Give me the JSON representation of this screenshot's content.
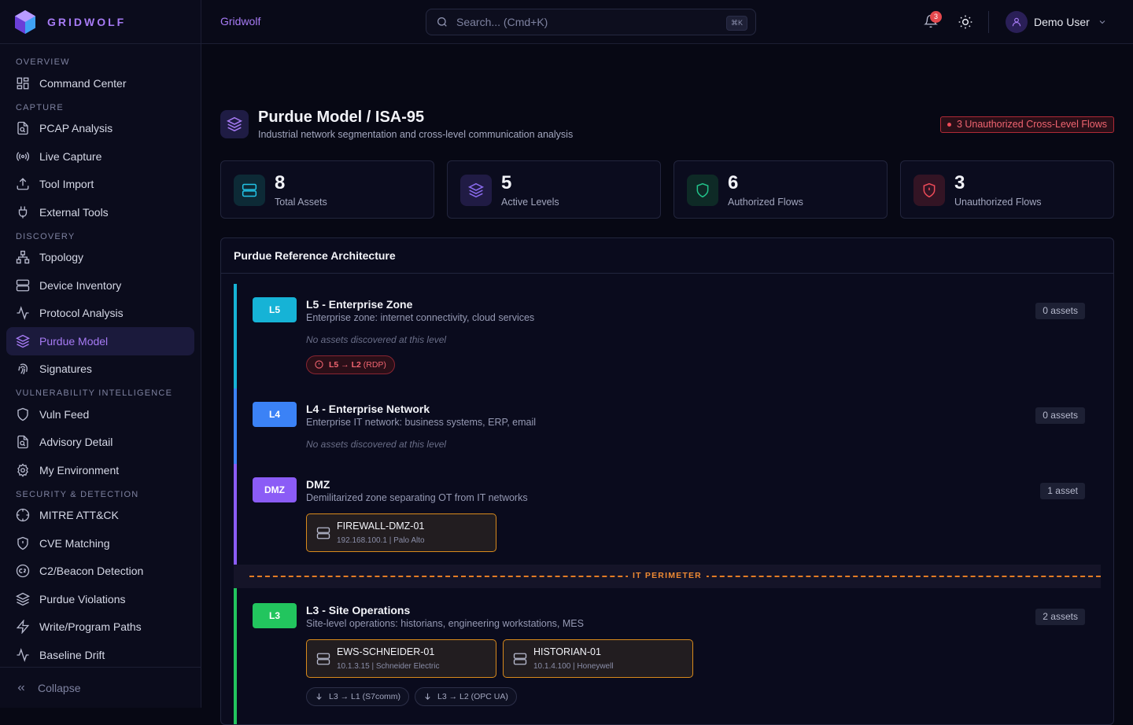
{
  "app": {
    "name": "GRIDWOLF",
    "brand": "Gridwolf"
  },
  "sidebar": {
    "sections": [
      {
        "title": "OVERVIEW",
        "items": [
          {
            "label": "Command Center",
            "icon": "grid-icon"
          }
        ]
      },
      {
        "title": "CAPTURE",
        "items": [
          {
            "label": "PCAP Analysis",
            "icon": "file-search-icon"
          },
          {
            "label": "Live Capture",
            "icon": "radio-icon"
          },
          {
            "label": "Tool Import",
            "icon": "upload-icon"
          },
          {
            "label": "External Tools",
            "icon": "plug-icon"
          }
        ]
      },
      {
        "title": "DISCOVERY",
        "items": [
          {
            "label": "Topology",
            "icon": "network-icon"
          },
          {
            "label": "Device Inventory",
            "icon": "server-icon"
          },
          {
            "label": "Protocol Analysis",
            "icon": "activity-icon"
          },
          {
            "label": "Purdue Model",
            "icon": "layers-icon",
            "active": true
          },
          {
            "label": "Signatures",
            "icon": "fingerprint-icon"
          }
        ]
      },
      {
        "title": "VULNERABILITY INTELLIGENCE",
        "items": [
          {
            "label": "Vuln Feed",
            "icon": "shield-icon"
          },
          {
            "label": "Advisory Detail",
            "icon": "file-search-icon"
          },
          {
            "label": "My Environment",
            "icon": "gear-icon"
          }
        ]
      },
      {
        "title": "SECURITY & DETECTION",
        "items": [
          {
            "label": "MITRE ATT&CK",
            "icon": "crosshair-icon"
          },
          {
            "label": "CVE Matching",
            "icon": "shield-alert-icon"
          },
          {
            "label": "C2/Beacon Detection",
            "icon": "c2-icon"
          },
          {
            "label": "Purdue Violations",
            "icon": "layers-icon"
          },
          {
            "label": "Write/Program Paths",
            "icon": "zap-icon"
          },
          {
            "label": "Baseline Drift",
            "icon": "activity-icon"
          }
        ]
      }
    ],
    "collapse_label": "Collapse"
  },
  "topbar": {
    "search_placeholder": "Search... (Cmd+K)",
    "shortcut": "⌘K",
    "notifications": "3",
    "user": "Demo User"
  },
  "page": {
    "title": "Purdue Model / ISA-95",
    "subtitle": "Industrial network segmentation and cross-level communication analysis",
    "alert": "3 Unauthorized Cross-Level Flows"
  },
  "stats": [
    {
      "value": "8",
      "label": "Total Assets",
      "color": "#22c3e6"
    },
    {
      "value": "5",
      "label": "Active Levels",
      "color": "#8b6cf0"
    },
    {
      "value": "6",
      "label": "Authorized Flows",
      "color": "#22c58b"
    },
    {
      "value": "3",
      "label": "Unauthorized Flows",
      "color": "#ef4b58"
    }
  ],
  "architecture": {
    "title": "Purdue Reference Architecture",
    "perimeter": "IT PERIMETER",
    "levels": [
      {
        "badge": "L5",
        "name": "L5 - Enterprise Zone",
        "desc": "Enterprise zone: internet connectivity, cloud services",
        "count": "0 assets",
        "empty": "No assets discovered at this level",
        "color": "#16b3d6",
        "flows": [
          {
            "route": "L5 → L2",
            "proto": "(RDP)"
          }
        ]
      },
      {
        "badge": "L4",
        "name": "L4 - Enterprise Network",
        "desc": "Enterprise IT network: business systems, ERP, email",
        "count": "0 assets",
        "empty": "No assets discovered at this level",
        "color": "#3b82f6"
      },
      {
        "badge": "DMZ",
        "name": "DMZ",
        "desc": "Demilitarized zone separating OT from IT networks",
        "count": "1 asset",
        "color": "#8b5cf6",
        "assets": [
          {
            "name": "FIREWALL-DMZ-01",
            "meta": "192.168.100.1 | Palo Alto"
          }
        ]
      },
      {
        "badge": "L3",
        "name": "L3 - Site Operations",
        "desc": "Site-level operations: historians, engineering workstations, MES",
        "count": "2 assets",
        "color": "#22c55e",
        "assets": [
          {
            "name": "EWS-SCHNEIDER-01",
            "meta": "10.1.3.15 | Schneider Electric"
          },
          {
            "name": "HISTORIAN-01",
            "meta": "10.1.4.100 | Honeywell"
          }
        ],
        "flows": [
          {
            "route": "L3 → L1",
            "proto": "(S7comm)"
          },
          {
            "route": "L3 → L2",
            "proto": "(OPC UA)"
          }
        ]
      }
    ]
  }
}
